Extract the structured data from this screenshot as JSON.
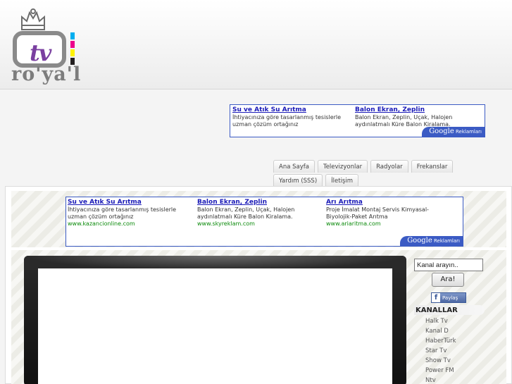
{
  "logo": {
    "name": "tv royal",
    "tv_text": "tv",
    "royal_text": "ro'ya'l",
    "cmyk_colors": [
      "#00aeef",
      "#ec008c",
      "#fff200",
      "#231f20"
    ]
  },
  "top_ad": {
    "items": [
      {
        "title": "Su ve Atık Su Arıtma",
        "text": "İhtiyacınıza göre tasarlanmış tesislerle uzman çözüm ortağınız",
        "url": ""
      },
      {
        "title": "Balon Ekran, Zeplin",
        "text": "Balon Ekran, Zeplin, Uçak, Halojen aydınlatmalı Küre Balon Kiralama.",
        "url": ""
      }
    ],
    "badge_google": "Google",
    "badge_text": "Reklamları"
  },
  "nav": {
    "row1": [
      "Ana Sayfa",
      "Televizyonlar",
      "Radyolar",
      "Frekanslar"
    ],
    "row2": [
      "Yardım (SSS)",
      "İletişim"
    ]
  },
  "mid_ad": {
    "items": [
      {
        "title": "Su ve Atık Su Arıtma",
        "text": "İhtiyacınıza göre tasarlanmış tesislerle uzman çözüm ortağınız",
        "url": "www.kazancionline.com"
      },
      {
        "title": "Balon Ekran, Zeplin",
        "text": "Balon Ekran, Zeplin, Uçak, Halojen aydınlatmalı Küre Balon Kiralama.",
        "url": "www.skyreklam.com"
      },
      {
        "title": "Arı Arıtma",
        "text": "Proje İmalat Montaj Servis Kimyasal-Biyolojik-Paket Arıtma",
        "url": "www.ariaritma.com"
      }
    ],
    "badge_google": "Google",
    "badge_text": "Reklamları"
  },
  "sidebar": {
    "search_value": "Kanal arayın..",
    "search_button": "Ara!",
    "share_label": "Paylaş",
    "share_icon": "f",
    "channels_title": "KANALLAR",
    "channels": [
      "Halk Tv",
      "Kanal D",
      "HaberTürk",
      "Star Tv",
      "Show Tv",
      "Power FM",
      "Ntv"
    ]
  }
}
